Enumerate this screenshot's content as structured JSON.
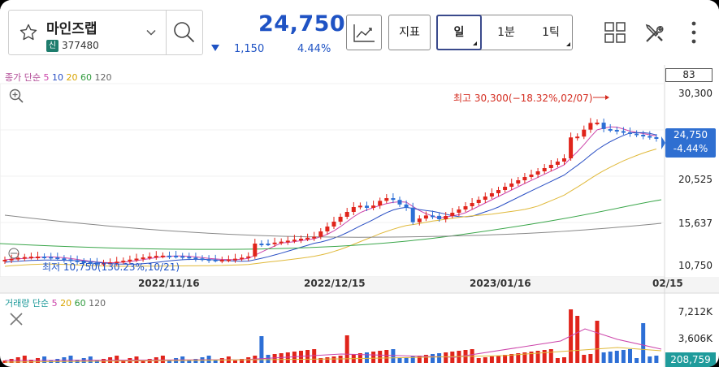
{
  "header": {
    "stock_name": "마인즈랩",
    "badge": "신",
    "code": "377480",
    "price": "24,750",
    "change": "1,150",
    "change_pct": "4.44%",
    "indicator_label": "지표",
    "periods": [
      "일",
      "1분",
      "1틱"
    ],
    "active_period": "일"
  },
  "chart": {
    "ma_legend": {
      "prefix": "종가 단순",
      "periods": [
        "5",
        "10",
        "20",
        "60",
        "120"
      ]
    },
    "vol_legend": {
      "prefix": "거래량 단순",
      "periods": [
        "5",
        "20",
        "60",
        "120"
      ]
    },
    "value_box": "83",
    "y_labels": [
      "30,300",
      "20,525",
      "15,637",
      "10,750"
    ],
    "vol_y_labels": [
      "7,212K",
      "3,606K"
    ],
    "x_labels": [
      "2022/11/16",
      "2022/12/15",
      "2023/01/16",
      "02/15"
    ],
    "price_tag": {
      "price": "24,750",
      "pct": "-4.44%"
    },
    "vol_tag": "208,759",
    "high_label": "최고 30,300(−18.32%,02/07)",
    "low_label": "최저 10,750(130.23%,10/21)",
    "colors": {
      "up": "#e0241b",
      "down": "#2d6fd6",
      "ma5": "#cc44aa",
      "ma10": "#2a4fc4",
      "ma20": "#e0b93a",
      "ma60": "#3aa64a",
      "ma120": "#888888"
    }
  }
}
